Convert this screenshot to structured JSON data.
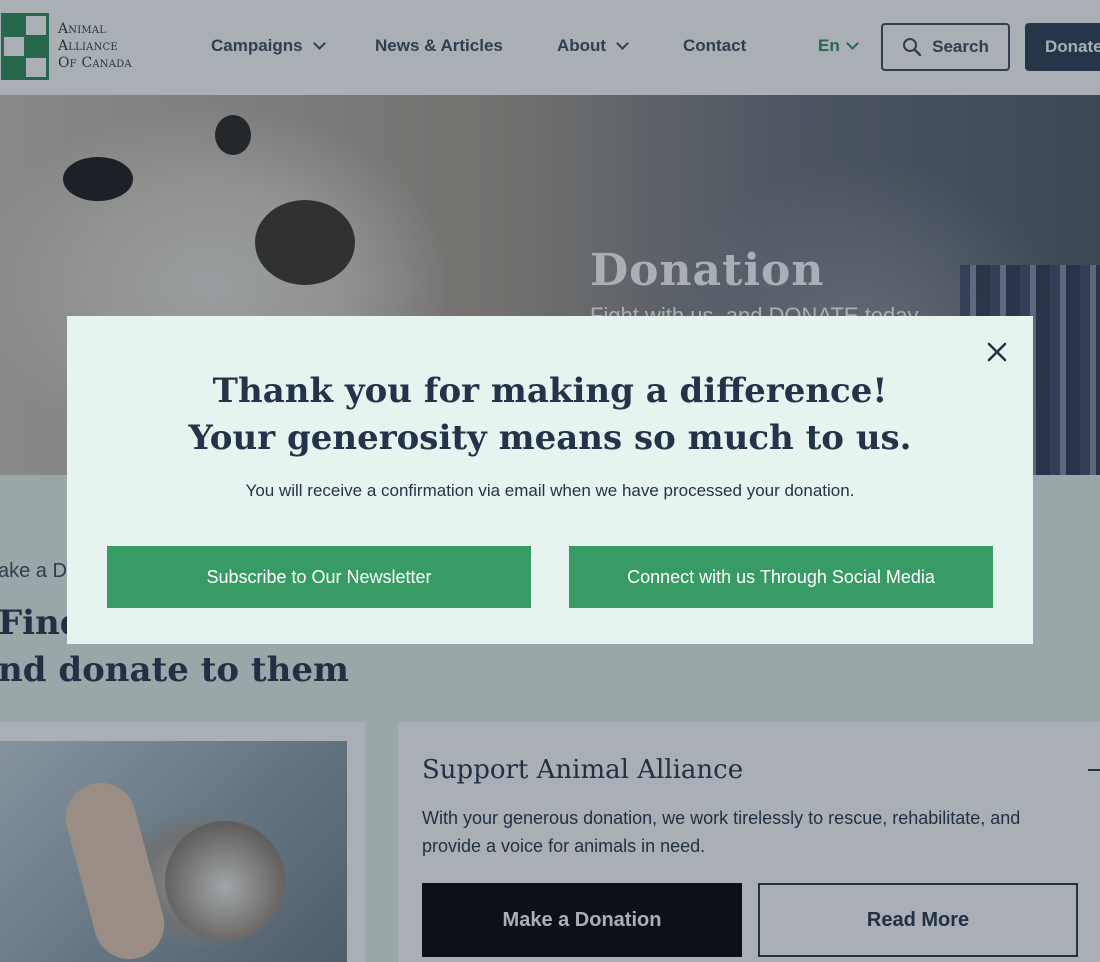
{
  "header": {
    "logo_lines": [
      "Animal",
      "Alliance",
      "Of Canada"
    ],
    "nav": {
      "campaigns": "Campaigns",
      "news": "News & Articles",
      "about": "About",
      "contact": "Contact"
    },
    "language": "En",
    "search_label": "Search",
    "donate_label": "Donate"
  },
  "hero": {
    "title": "Donation",
    "subtitle": "Fight with us, and DONATE today"
  },
  "main": {
    "breadcrumb": "ake a D",
    "title_line1": "Find",
    "title_line2": "nd donate to them"
  },
  "support_card": {
    "title": "Support Animal Alliance",
    "text": "With your generous donation, we work tirelessly to rescue, rehabilitate, and provide a voice for animals in need.",
    "make_donation": "Make a Donation",
    "read_more": "Read More"
  },
  "modal": {
    "title_line1": "Thank you for making a difference!",
    "title_line2": "Your generosity means so much to us.",
    "message": "You will receive a confirmation via email when we have processed your donation.",
    "newsletter_button": "Subscribe to Our Newsletter",
    "social_button": "Connect with us Through Social Media"
  },
  "colors": {
    "brand_green": "#389a64",
    "navy": "#24334a",
    "modal_bg": "#e6f3ee"
  },
  "icons": [
    "search-icon",
    "close-icon",
    "chevron-down-icon",
    "logo-mark-icon"
  ]
}
